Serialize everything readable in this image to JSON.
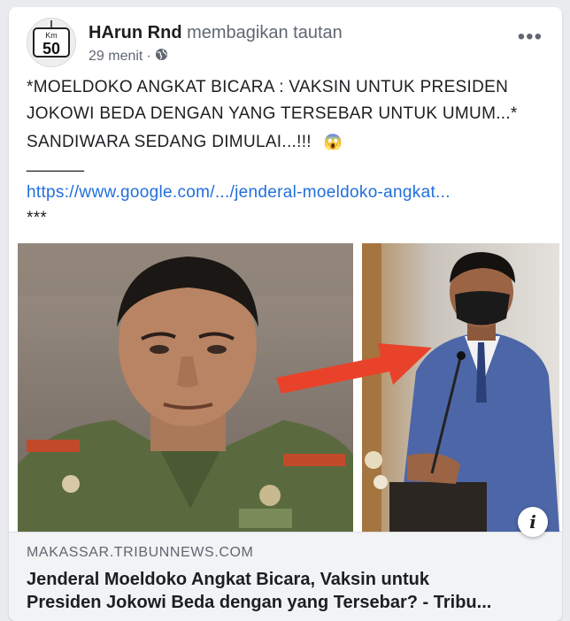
{
  "post": {
    "author": "HArun Rnd",
    "action": "membagikan tautan",
    "time": "29 menit",
    "more_icon": "•••",
    "avatar": {
      "sign_top": "Km",
      "sign_number": "50"
    },
    "lines": [
      "*MOELDOKO ANGKAT BICARA : VAKSIN UNTUK PRESIDEN",
      "JOKOWI BEDA DENGAN YANG TERSEBAR UNTUK UMUM...*",
      "SANDIWARA SEDANG DIMULAI...!!!"
    ],
    "emoji": "😱",
    "separator": "______",
    "url": "https://www.google.com/.../jenderal-moeldoko-angkat...",
    "stars": "***"
  },
  "preview": {
    "domain": "MAKASSAR.TRIBUNNEWS.COM",
    "title_line1": "Jenderal Moeldoko Angkat Bicara, Vaksin untuk",
    "title_line2": "Presiden Jokowi Beda dengan yang Tersebar? - Tribu...",
    "info_icon": "i"
  },
  "colors": {
    "link": "#216fdb",
    "arrow": "#e8432a",
    "background": "#e9ebee"
  }
}
